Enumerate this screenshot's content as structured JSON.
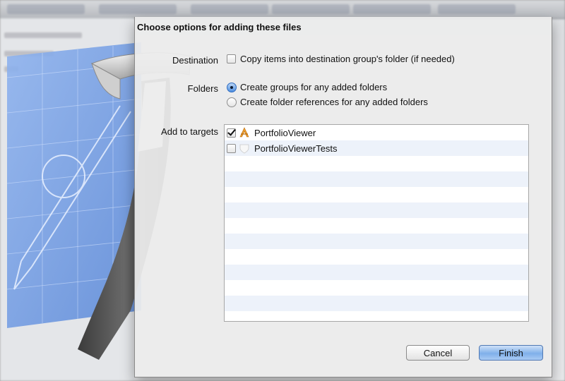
{
  "background": {
    "toolbar_tabs": [
      "PortfolioViewer",
      "PortfolioViewer",
      "iPhone 6.0 Simulator",
      "Running PortfolioViewer",
      "View Controller",
      "View Controller"
    ],
    "sidebar_rows": [
      "View Controller Scene",
      "View Controller"
    ]
  },
  "sheet": {
    "title": "Choose options for adding these files",
    "destination": {
      "label": "Destination",
      "option_label": "Copy items into destination group's folder (if needed)",
      "checked": false
    },
    "folders": {
      "label": "Folders",
      "options": [
        {
          "label": "Create groups for any added folders",
          "selected": true
        },
        {
          "label": "Create folder references for any added folders",
          "selected": false
        }
      ]
    },
    "targets": {
      "label": "Add to targets",
      "items": [
        {
          "name": "PortfolioViewer",
          "checked": true,
          "icon": "app-target-icon"
        },
        {
          "name": "PortfolioViewerTests",
          "checked": false,
          "icon": "test-target-icon"
        }
      ]
    },
    "buttons": {
      "cancel": "Cancel",
      "finish": "Finish"
    }
  },
  "colors": {
    "accent": "#4f8fe0",
    "art_blue": "#6f9be0"
  }
}
